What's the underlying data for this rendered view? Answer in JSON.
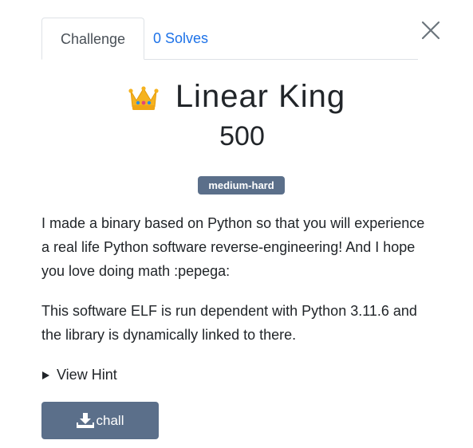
{
  "tabs": [
    {
      "label": "Challenge"
    },
    {
      "label": "0 Solves"
    }
  ],
  "challenge": {
    "icon": "crown-icon",
    "name": "Linear King",
    "points": "500",
    "tag": "medium-hard",
    "description": [
      "I made a binary based on Python so that you will experience a real life Python software reverse-engineering! And I hope you love doing math :pepega:",
      "This software ELF is run dependent with Python 3.11.6 and the library is dynamically linked to there."
    ],
    "hint_label": "View Hint",
    "file_label": "chall"
  },
  "colors": {
    "accent": "#5b6f8a",
    "link": "#1d72e8"
  }
}
